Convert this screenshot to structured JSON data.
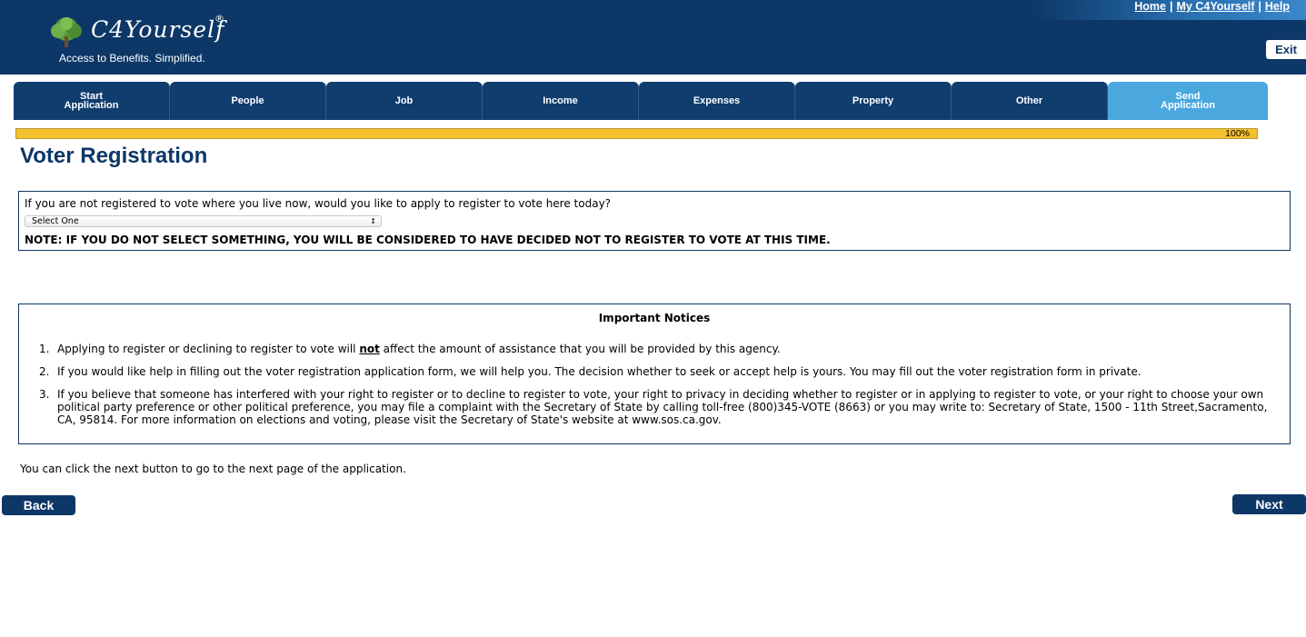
{
  "header": {
    "logo_text": "C4Yourself",
    "logo_reg": "®",
    "tagline": "Access to Benefits.  Simplified.",
    "links": [
      "Home",
      "My C4Yourself",
      "Help"
    ],
    "link_separator": "|",
    "exit_label": "Exit"
  },
  "tabs": [
    {
      "line1": "Start",
      "line2": "Application"
    },
    {
      "line1": "People",
      "line2": ""
    },
    {
      "line1": "Job",
      "line2": ""
    },
    {
      "line1": "Income",
      "line2": ""
    },
    {
      "line1": "Expenses",
      "line2": ""
    },
    {
      "line1": "Property",
      "line2": ""
    },
    {
      "line1": "Other",
      "line2": ""
    },
    {
      "line1": "Send",
      "line2": "Application"
    }
  ],
  "active_tab": "Send Application",
  "progress": {
    "value": 100,
    "label": "100%"
  },
  "page_title": "Voter Registration",
  "voter_question": {
    "text": "If you are not registered to vote where you live now, would you like to apply to register to vote here today?",
    "select_value": "Select One",
    "note": "NOTE: IF YOU DO NOT SELECT SOMETHING, YOU WILL BE CONSIDERED TO HAVE DECIDED NOT TO REGISTER TO VOTE AT THIS TIME."
  },
  "notices": {
    "title": "Important Notices",
    "item1_num": "1.",
    "item1_before": "Applying to register or declining to register to vote will ",
    "item1_emph": "not",
    "item1_after": " affect the amount of assistance that you will be provided by this agency.",
    "item2_num": "2.",
    "item2": "If you would like help in filling out the voter registration application form, we will help you. The decision whether to seek or accept help is yours. You may fill out the voter registration form in private.",
    "item3_num": "3.",
    "item3": "If you believe that someone has interfered with your right to register or to decline to register to vote, your right to privacy in deciding whether to register or in applying to register to vote, or your right to choose your own political party preference or other political preference, you may file a complaint with the Secretary of State by calling toll-free (800)345-VOTE (8663) or you may write to: Secretary of State, 1500 - 11th Street,Sacramento, CA, 95814. For more information on elections and voting, please visit the Secretary of State's website at www.sos.ca.gov."
  },
  "hint": "You can click the next button to go to the next page of the application.",
  "buttons": {
    "back": "Back",
    "next": "Next"
  },
  "colors": {
    "header_bg": "#0d3767",
    "tab_bg": "#0f3d6e",
    "tab_active": "#4aa8df",
    "progress": "#f5c12e"
  }
}
